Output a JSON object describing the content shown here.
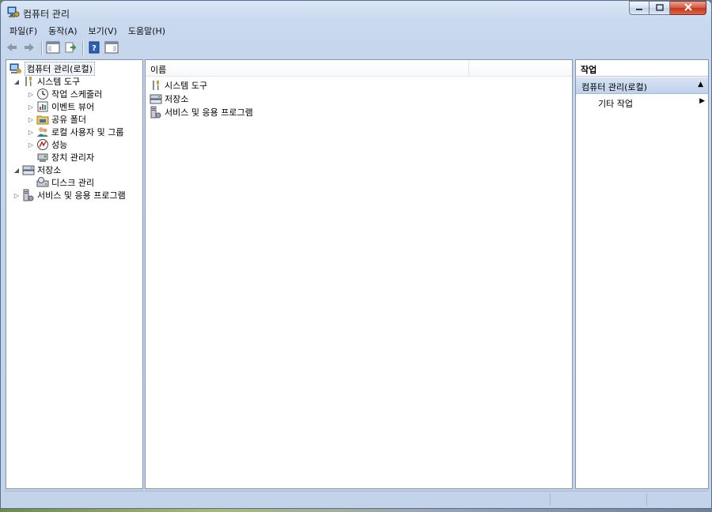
{
  "window": {
    "title": "컴퓨터 관리"
  },
  "menu": [
    "파일(F)",
    "동작(A)",
    "보기(V)",
    "도움말(H)"
  ],
  "toolbar_icons": [
    "back-arrow-icon",
    "forward-arrow-icon",
    "show-hide-console-tree-icon",
    "export-list-icon",
    "help-icon",
    "show-hide-action-pane-icon"
  ],
  "tree": {
    "root": "컴퓨터 관리(로컬)",
    "system_tools": "시스템 도구",
    "task_scheduler": "작업 스케줄러",
    "event_viewer": "이벤트 뷰어",
    "shared_folders": "공유 폴더",
    "local_users": "로컬 사용자 및 그룹",
    "performance": "성능",
    "device_manager": "장치 관리자",
    "storage": "저장소",
    "disk_management": "디스크 관리",
    "services_apps": "서비스 및 응용 프로그램"
  },
  "list": {
    "column_name": "이름",
    "items": [
      "시스템 도구",
      "저장소",
      "서비스 및 응용 프로그램"
    ]
  },
  "actions": {
    "title": "작업",
    "group": "컴퓨터 관리(로컬)",
    "item": "기타 작업"
  }
}
